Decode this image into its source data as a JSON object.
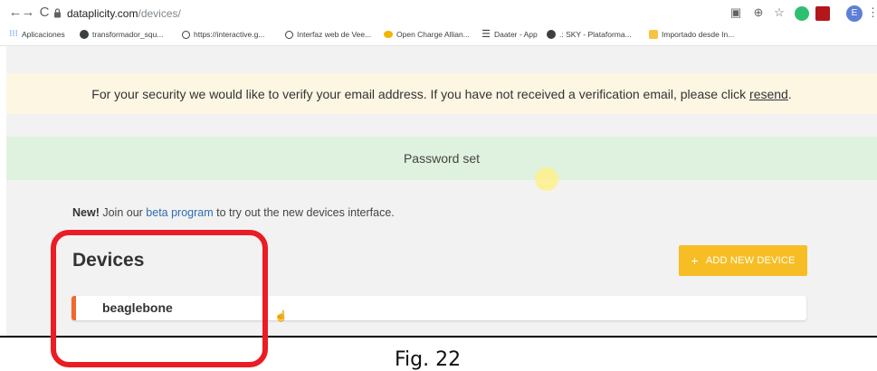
{
  "browser": {
    "url_host": "dataplicity.com",
    "url_path": "/devices/",
    "profile_initial": "E",
    "bookmarks": [
      {
        "label": "Aplicaciones",
        "icon": "apps-grid-icon"
      },
      {
        "label": "transformador_squ...",
        "icon": "globe-icon"
      },
      {
        "label": "https://interactive.g...",
        "icon": "loading-icon"
      },
      {
        "label": "Interfaz web de Vee...",
        "icon": "loading-icon"
      },
      {
        "label": "Open Charge Allian...",
        "icon": "charge-icon"
      },
      {
        "label": "Daater - App",
        "icon": "menu-icon"
      },
      {
        "label": ".: SKY - Plataforma...",
        "icon": "globe-icon"
      },
      {
        "label": "Importado desde In...",
        "icon": "folder-icon"
      }
    ]
  },
  "page": {
    "verify_text": "For your security we would like to verify your email address. If you have not received a verification email, please click",
    "resend_link": "resend",
    "verify_end": ".",
    "password_message": "Password set",
    "beta_new": "New!",
    "beta_prefix": " Join our ",
    "beta_link": "beta program",
    "beta_suffix": " to try out the new devices interface.",
    "devices_title": "Devices",
    "add_device_label": "ADD NEW DEVICE",
    "add_plus": "+",
    "devices": [
      {
        "name": "beaglebone"
      }
    ]
  },
  "caption": "Fig. 22",
  "colors": {
    "add_button": "#f6be24",
    "device_accent": "#f06a2c",
    "highlight": "#ea1c24",
    "verify_banner": "#fdf6e3",
    "password_banner": "#dff2df"
  }
}
